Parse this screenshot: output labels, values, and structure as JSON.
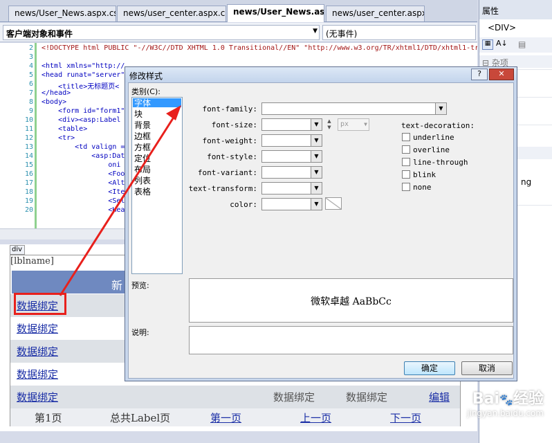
{
  "tabs": [
    "news/User_News.aspx.cs",
    "news/user_center.aspx.cs",
    "news/User_News.aspx",
    "news/user_center.aspx"
  ],
  "objbar": {
    "objects": "客户端对象和事件",
    "events": "(无事件)"
  },
  "code": {
    "lines": [
      {
        "n": "2",
        "t": "<!DOCTYPE html PUBLIC \"-//W3C//DTD XHTML 1.0 Transitional//EN\" \"http://www.w3.org/TR/xhtml1/DTD/xhtml1-tr"
      },
      {
        "n": "3",
        "t": ""
      },
      {
        "n": "4",
        "t": "<html xmlns=\"http://"
      },
      {
        "n": "5",
        "t": "<head runat=\"server\""
      },
      {
        "n": "6",
        "t": "    <title>无标题页<"
      },
      {
        "n": "7",
        "t": "</head>"
      },
      {
        "n": "8",
        "t": "<body>"
      },
      {
        "n": "9",
        "t": "    <form id=\"form1\""
      },
      {
        "n": "10",
        "t": "    <div><asp:Label"
      },
      {
        "n": "11",
        "t": "    <table>"
      },
      {
        "n": "12",
        "t": "    <tr>"
      },
      {
        "n": "13",
        "t": "        <td valign ="
      },
      {
        "n": "14",
        "t": "            <asp:Dat"
      },
      {
        "n": "15",
        "t": "                oni"
      },
      {
        "n": "16",
        "t": "                <Foo"
      },
      {
        "n": "17",
        "t": "                <Alt"
      },
      {
        "n": "18",
        "t": "                <Ite"
      },
      {
        "n": "19",
        "t": "                <Sel"
      },
      {
        "n": "20",
        "t": "                <Hea"
      }
    ]
  },
  "design": {
    "divtag": "div",
    "lblname": "[lblname]",
    "header": "新",
    "rows": [
      "数据绑定",
      "数据绑定",
      "数据绑定",
      "数据绑定",
      "数据绑定"
    ],
    "row_extra": [
      "数据绑定",
      "数据绑定",
      "编辑"
    ],
    "pager": [
      "第1页",
      "总共Label页",
      "第一页",
      "上一页",
      "下一页"
    ]
  },
  "props": {
    "title": "属性",
    "selected": "<DIV>",
    "section": "杂项",
    "partial": "ng"
  },
  "dialog": {
    "title": "修改样式",
    "category_label": "类别(C):",
    "categories": [
      "字体",
      "块",
      "背景",
      "边框",
      "方框",
      "定位",
      "布局",
      "列表",
      "表格"
    ],
    "fields": {
      "font_family": "font-family:",
      "font_size": "font-size:",
      "font_weight": "font-weight:",
      "font_style": "font-style:",
      "font_variant": "font-variant:",
      "text_transform": "text-transform:",
      "color": "color:",
      "unit": "px"
    },
    "decoration_label": "text-decoration:",
    "decorations": [
      "underline",
      "overline",
      "line-through",
      "blink",
      "none"
    ],
    "preview_label": "预览:",
    "preview_text": "微软卓越 AaBbCc",
    "desc_label": "说明:",
    "ok": "确定",
    "cancel": "取消",
    "help": "?",
    "close": "✕"
  },
  "watermark": "Bai 经验 jingyan.baidu.com",
  "colors": {
    "highlight": "#3399ff",
    "arrow": "#e8201c",
    "accent_blue": "#6f89c0"
  }
}
